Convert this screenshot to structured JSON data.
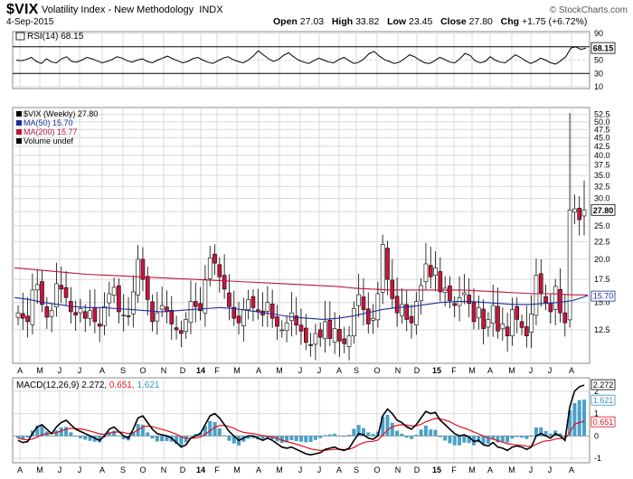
{
  "header": {
    "symbol": "$VIX",
    "name": "Volatility Index - New Methodology",
    "exchange": "INDX",
    "date": "4-Sep-2015",
    "copyright": "© StockCharts.com",
    "open_label": "Open",
    "open": "27.03",
    "high_label": "High",
    "high": "33.82",
    "low_label": "Low",
    "low": "23.45",
    "close_label": "Close",
    "close": "27.80",
    "chg_label": "Chg",
    "chg": "+1.75 (+6.72%)"
  },
  "rsi_panel": {
    "label": "RSI(14) 68.15",
    "value_badge": "68.15",
    "ticks": [
      "90",
      "70",
      "50",
      "30",
      "10"
    ]
  },
  "price_panel": {
    "legend": [
      {
        "text": "$VIX (Weekly) 27.80",
        "color": "#000000"
      },
      {
        "text": "MA(50) 15.70",
        "color": "#1c2f9c"
      },
      {
        "text": "MA(200) 15.77",
        "color": "#c0143c"
      },
      {
        "text": "Volume undef",
        "color": "#000000"
      }
    ],
    "close_badge": "27.80",
    "ma_badge": "15.70",
    "ticks": [
      "52.5",
      "50.0",
      "47.5",
      "45.0",
      "42.5",
      "40.0",
      "37.5",
      "35.0",
      "32.5",
      "30.0",
      "27.5",
      "25.0",
      "22.5",
      "20.0",
      "17.5",
      "15.0",
      "12.5"
    ]
  },
  "macd_panel": {
    "label_prefix": "MACD(12,26,9)",
    "macd": "2.272",
    "signal": "0.651",
    "hist": "1.621",
    "ticks": [
      "2",
      "1",
      "0",
      "-1"
    ]
  },
  "x_axis_labels": [
    "A",
    "M",
    "J",
    "J",
    "A",
    "S",
    "O",
    "N",
    "D",
    "14",
    "F",
    "M",
    "A",
    "M",
    "J",
    "J",
    "A",
    "S",
    "O",
    "N",
    "D",
    "15",
    "F",
    "M",
    "A",
    "M",
    "J",
    "J",
    "A"
  ],
  "colors": {
    "up": "#ffffff",
    "down": "#cc1440",
    "ma50": "#1c2f9c",
    "ma200": "#c0143c",
    "hist": "#4aa0c8",
    "signal": "#e01020",
    "macd": "#000000",
    "grid": "#d8d8d8"
  },
  "chart_data": [
    {
      "type": "line",
      "title": "RSI(14)",
      "ylim": [
        0,
        100
      ],
      "reference_lines": [
        70,
        50,
        30
      ],
      "x_range": [
        "2013-04",
        "2015-09"
      ],
      "series": [
        {
          "name": "RSI(14)",
          "values": [
            50,
            49,
            51,
            54,
            48,
            45,
            52,
            47,
            46,
            52,
            55,
            48,
            47,
            50,
            54,
            52,
            49,
            46,
            48,
            51,
            55,
            53,
            49,
            47,
            50,
            52,
            48,
            46,
            50,
            53,
            56,
            52,
            49,
            46,
            48,
            52,
            54,
            50,
            47,
            45,
            49,
            53,
            55,
            51,
            48,
            46,
            50,
            56,
            64,
            58,
            52,
            48,
            51,
            57,
            61,
            55,
            50,
            47,
            45,
            49,
            53,
            50,
            47,
            46,
            51,
            54,
            49,
            45,
            47,
            52,
            60,
            63,
            56,
            51,
            48,
            45,
            47,
            52,
            58,
            55,
            50,
            46,
            45,
            49,
            54,
            51,
            47,
            46,
            52,
            60,
            57,
            49,
            46,
            48,
            55,
            50,
            47,
            46,
            52,
            58,
            54,
            49,
            45,
            48,
            53,
            50,
            46,
            44,
            49,
            55,
            68,
            70,
            66,
            68.15
          ]
        }
      ]
    },
    {
      "type": "line",
      "title": "$VIX (Weekly) 27.80",
      "x_range": [
        "2013-04",
        "2015-09"
      ],
      "log_scale": true,
      "ylim": [
        10,
        55
      ],
      "series": [
        {
          "name": "MA(50)",
          "values": [
            15.5,
            15.3,
            15.0,
            14.8,
            14.6,
            14.5,
            14.5,
            14.4,
            14.3,
            14.2,
            14.1,
            14.2,
            14.3,
            14.4,
            14.5,
            14.4,
            14.2,
            14.0,
            13.8,
            13.6,
            13.5,
            13.4,
            13.5,
            13.7,
            14.0,
            14.3,
            14.5,
            14.6,
            14.8,
            15.0,
            15.1,
            15.1,
            15.0,
            14.9,
            14.8,
            14.8,
            14.9,
            15.0,
            15.2,
            15.7
          ]
        },
        {
          "name": "MA(200)",
          "values": [
            18.9,
            18.7,
            18.5,
            18.3,
            18.1,
            18.0,
            17.9,
            17.8,
            17.7,
            17.6,
            17.5,
            17.4,
            17.3,
            17.2,
            17.1,
            17.0,
            16.9,
            16.8,
            16.7,
            16.5,
            16.4,
            16.3,
            16.3,
            16.3,
            16.3,
            16.3,
            16.2,
            16.1,
            16.0,
            15.9,
            15.9,
            15.8,
            15.77
          ]
        },
        {
          "name": "$VIX close",
          "values": [
            14.0,
            13.5,
            13.2,
            16.3,
            16.9,
            14.8,
            13.6,
            14.2,
            17.0,
            16.4,
            15.5,
            14.1,
            13.8,
            14.4,
            13.5,
            14.2,
            13.2,
            12.8,
            14.6,
            15.9,
            16.6,
            14.1,
            13.8,
            13.7,
            16.1,
            20.0,
            17.5,
            15.3,
            13.2,
            14.0,
            14.7,
            14.1,
            13.0,
            12.5,
            12.2,
            13.4,
            15.1,
            14.6,
            14.2,
            17.5,
            20.2,
            19.5,
            17.8,
            16.4,
            14.6,
            13.5,
            13.1,
            14.3,
            15.3,
            14.5,
            14.1,
            13.8,
            15.0,
            13.5,
            12.8,
            12.5,
            13.1,
            14.0,
            12.9,
            12.4,
            11.5,
            11.3,
            12.2,
            11.9,
            13.2,
            11.8,
            12.6,
            11.6,
            11.4,
            12.0,
            14.4,
            15.8,
            14.3,
            13.0,
            13.5,
            15.9,
            22.1,
            17.5,
            15.4,
            14.0,
            14.8,
            13.4,
            13.1,
            15.1,
            16.8,
            19.4,
            17.8,
            18.9,
            16.1,
            16.5,
            15.2,
            14.7,
            15.5,
            16.0,
            14.9,
            13.2,
            14.5,
            12.6,
            13.4,
            14.7,
            12.4,
            13.0,
            12.0,
            14.3,
            13.4,
            12.7,
            12.0,
            13.9,
            18.0,
            16.0,
            15.0,
            14.1,
            16.7,
            14.0,
            13.1,
            27.8,
            28.0,
            26.05,
            27.8
          ]
        }
      ]
    },
    {
      "type": "bar",
      "title": "MACD(12,26,9)",
      "ylim": [
        -1.2,
        2.6
      ],
      "series": [
        {
          "name": "MACD",
          "values": [
            -0.2,
            -0.3,
            -0.25,
            0.1,
            0.4,
            0.5,
            0.3,
            0.1,
            0.4,
            0.6,
            0.7,
            0.5,
            0.3,
            0.2,
            0.1,
            0.0,
            -0.1,
            -0.2,
            0.0,
            0.3,
            0.4,
            0.2,
            0.0,
            -0.1,
            0.3,
            0.8,
            0.9,
            0.6,
            0.3,
            0.1,
            0.05,
            0.0,
            -0.1,
            -0.3,
            -0.5,
            -0.4,
            -0.1,
            0.0,
            0.1,
            0.5,
            0.9,
            1.0,
            0.8,
            0.5,
            0.2,
            0.0,
            -0.2,
            -0.1,
            0.0,
            0.0,
            -0.1,
            -0.2,
            -0.1,
            -0.2,
            -0.35,
            -0.5,
            -0.55,
            -0.5,
            -0.6,
            -0.7,
            -0.8,
            -0.85,
            -0.8,
            -0.75,
            -0.6,
            -0.55,
            -0.5,
            -0.6,
            -0.65,
            -0.55,
            -0.2,
            0.1,
            0.05,
            -0.1,
            -0.15,
            0.0,
            0.9,
            1.2,
            1.0,
            0.7,
            0.6,
            0.4,
            0.3,
            0.5,
            0.8,
            1.1,
            1.0,
            1.05,
            0.7,
            0.5,
            0.3,
            0.1,
            0.0,
            0.05,
            -0.05,
            -0.25,
            -0.2,
            -0.4,
            -0.45,
            -0.3,
            -0.5,
            -0.55,
            -0.65,
            -0.5,
            -0.45,
            -0.5,
            -0.6,
            -0.5,
            0.0,
            0.1,
            0.0,
            -0.1,
            0.1,
            0.0,
            -0.2,
            1.3,
            2.0,
            2.2,
            2.272
          ]
        },
        {
          "name": "Signal",
          "values": [
            -0.1,
            -0.15,
            -0.18,
            -0.14,
            -0.05,
            0.05,
            0.1,
            0.1,
            0.15,
            0.22,
            0.3,
            0.34,
            0.33,
            0.31,
            0.27,
            0.22,
            0.16,
            0.09,
            0.07,
            0.11,
            0.17,
            0.18,
            0.15,
            0.1,
            0.14,
            0.27,
            0.4,
            0.44,
            0.41,
            0.35,
            0.29,
            0.23,
            0.16,
            0.07,
            -0.04,
            -0.11,
            -0.11,
            -0.09,
            -0.05,
            0.06,
            0.23,
            0.38,
            0.46,
            0.47,
            0.42,
            0.34,
            0.23,
            0.16,
            0.13,
            0.1,
            0.06,
            0.01,
            -0.01,
            -0.05,
            -0.11,
            -0.19,
            -0.26,
            -0.31,
            -0.37,
            -0.44,
            -0.51,
            -0.58,
            -0.62,
            -0.65,
            -0.64,
            -0.62,
            -0.6,
            -0.6,
            -0.61,
            -0.6,
            -0.52,
            -0.39,
            -0.3,
            -0.26,
            -0.24,
            -0.19,
            0.03,
            0.26,
            0.41,
            0.47,
            0.5,
            0.48,
            0.44,
            0.45,
            0.52,
            0.64,
            0.71,
            0.78,
            0.76,
            0.71,
            0.63,
            0.52,
            0.42,
            0.35,
            0.27,
            0.17,
            0.09,
            -0.01,
            -0.1,
            -0.14,
            -0.21,
            -0.28,
            -0.35,
            -0.38,
            -0.4,
            -0.42,
            -0.46,
            -0.47,
            -0.38,
            -0.28,
            -0.22,
            -0.2,
            -0.14,
            -0.11,
            -0.13,
            0.16,
            0.53,
            0.6,
            0.651
          ]
        },
        {
          "name": "Histogram",
          "values": [
            -0.1,
            -0.15,
            -0.07,
            0.24,
            0.45,
            0.45,
            0.2,
            0.0,
            0.25,
            0.38,
            0.4,
            0.16,
            -0.03,
            -0.11,
            -0.17,
            -0.22,
            -0.26,
            -0.29,
            -0.07,
            0.19,
            0.23,
            0.02,
            -0.15,
            -0.2,
            0.16,
            0.53,
            0.5,
            0.16,
            -0.11,
            -0.25,
            -0.24,
            -0.23,
            -0.26,
            -0.37,
            -0.46,
            -0.29,
            0.01,
            0.09,
            0.15,
            0.44,
            0.67,
            0.62,
            0.34,
            0.03,
            -0.22,
            -0.34,
            -0.43,
            -0.26,
            -0.13,
            -0.1,
            -0.16,
            -0.21,
            -0.09,
            -0.15,
            -0.24,
            -0.31,
            -0.29,
            -0.19,
            -0.23,
            -0.26,
            -0.29,
            -0.27,
            -0.18,
            -0.1,
            0.04,
            0.07,
            0.1,
            0.0,
            -0.04,
            0.05,
            0.32,
            0.49,
            0.35,
            0.16,
            0.09,
            0.19,
            0.87,
            0.94,
            0.59,
            0.23,
            0.1,
            -0.08,
            -0.14,
            0.05,
            0.28,
            0.46,
            0.29,
            0.27,
            -0.06,
            -0.21,
            -0.33,
            -0.42,
            -0.42,
            -0.3,
            -0.32,
            -0.42,
            -0.29,
            -0.39,
            -0.35,
            -0.16,
            -0.29,
            -0.27,
            -0.3,
            -0.12,
            -0.05,
            -0.08,
            -0.14,
            -0.03,
            0.38,
            0.38,
            0.22,
            0.1,
            0.24,
            0.11,
            -0.07,
            1.14,
            1.47,
            1.6,
            1.621
          ]
        }
      ]
    }
  ]
}
